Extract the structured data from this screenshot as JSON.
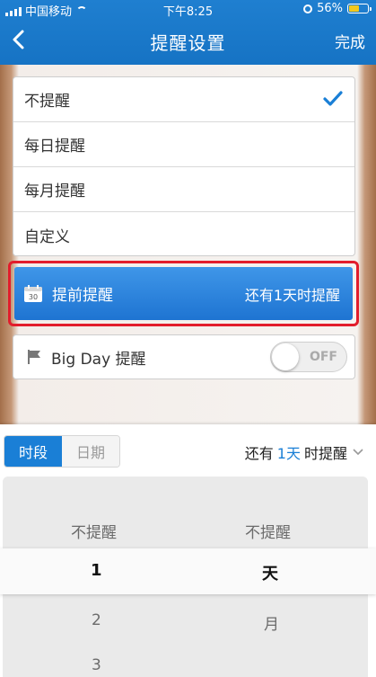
{
  "status_bar": {
    "carrier": "中国移动",
    "time": "下午8:25",
    "battery_percent": "56%",
    "battery_level": 0.56
  },
  "nav": {
    "title": "提醒设置",
    "done_label": "完成"
  },
  "reminder_options": [
    {
      "label": "不提醒",
      "selected": true
    },
    {
      "label": "每日提醒",
      "selected": false
    },
    {
      "label": "每月提醒",
      "selected": false
    },
    {
      "label": "自定义",
      "selected": false
    }
  ],
  "advance_reminder": {
    "label": "提前提醒",
    "value": "还有1天时提醒",
    "calendar_day": "30"
  },
  "big_day": {
    "label": "Big Day 提醒",
    "toggle_label": "OFF",
    "enabled": false
  },
  "picker": {
    "tabs": [
      {
        "label": "时段",
        "active": true
      },
      {
        "label": "日期",
        "active": false
      }
    ],
    "summary_prefix": "还有",
    "summary_number": "1天",
    "summary_suffix": "时提醒",
    "left_column": [
      "不提醒",
      "1",
      "2",
      "3"
    ],
    "right_column": [
      "不提醒",
      "天",
      "月"
    ],
    "selected_left": "1",
    "selected_right": "天"
  },
  "colors": {
    "accent": "#1a7fd6",
    "highlight_border": "#e21d2c",
    "battery_fill": "#f2c81d"
  }
}
